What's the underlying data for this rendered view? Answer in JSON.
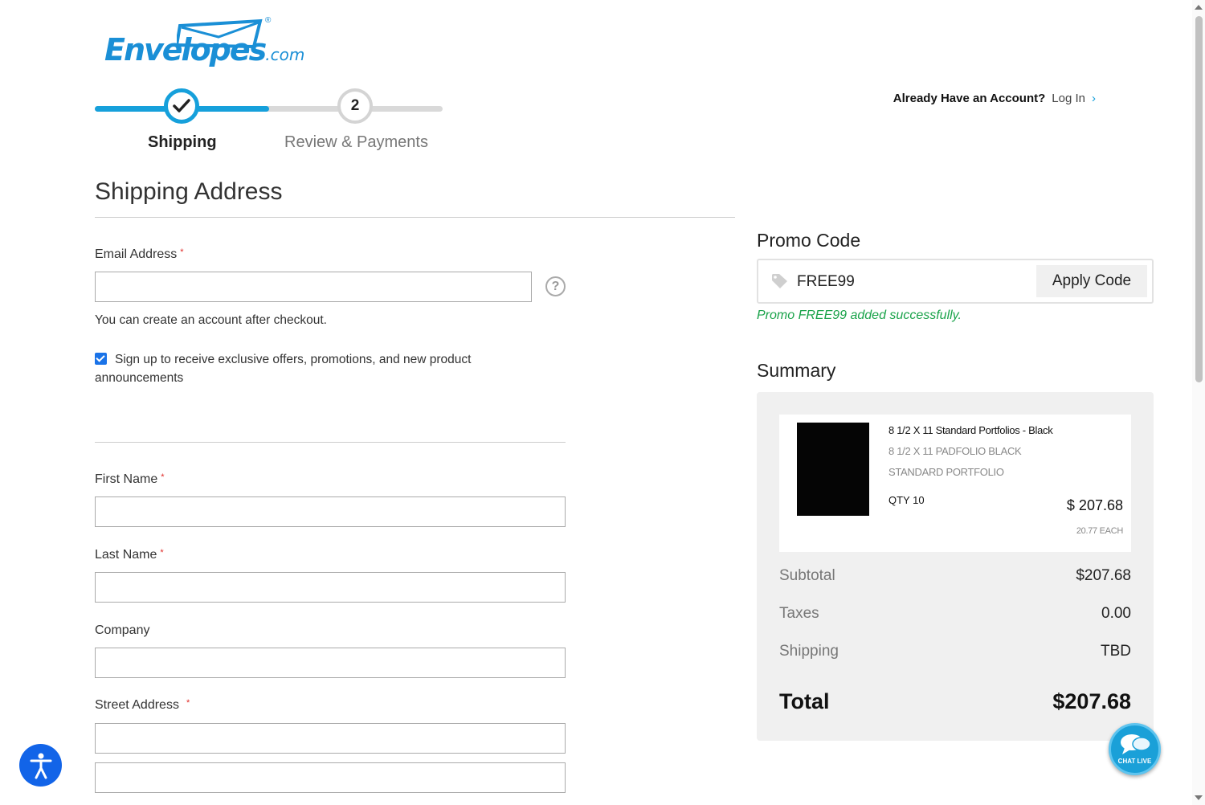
{
  "logo": {
    "text": "Envelopes",
    "suffix": ".com",
    "registered": "®"
  },
  "stepper": {
    "steps": [
      {
        "label": "Shipping",
        "state": "complete"
      },
      {
        "number": "2",
        "label": "Review & Payments",
        "state": "pending"
      }
    ]
  },
  "account": {
    "question": "Already Have an Account?",
    "login_label": "Log In",
    "chevron": "›"
  },
  "shipping": {
    "title": "Shipping Address",
    "email": {
      "label": "Email Address",
      "value": "",
      "help": "?"
    },
    "note": "You can create an account after checkout.",
    "signup": {
      "checked": true,
      "label": "Sign up to receive exclusive offers, promotions, and new product announcements"
    },
    "first_name": {
      "label": "First Name",
      "value": ""
    },
    "last_name": {
      "label": "Last Name",
      "value": ""
    },
    "company": {
      "label": "Company",
      "value": ""
    },
    "street": {
      "label": "Street Address",
      "line1": "",
      "line2": ""
    },
    "required_mark": "*"
  },
  "promo": {
    "title": "Promo Code",
    "value": "FREE99",
    "apply_label": "Apply Code",
    "success": "Promo FREE99 added successfully."
  },
  "summary": {
    "title": "Summary",
    "item": {
      "name": "8 1/2 X 11 Standard Portfolios - Black",
      "option1": "8 1/2 X 11 PADFOLIO   BLACK",
      "option2": "STANDARD PORTFOLIO",
      "qty": "QTY 10",
      "price": "$ 207.68",
      "each": "20.77 EACH"
    },
    "rows": [
      {
        "label": "Subtotal",
        "value": "$207.68"
      },
      {
        "label": "Taxes",
        "value": "0.00"
      },
      {
        "label": "Shipping",
        "value": "TBD"
      }
    ],
    "total": {
      "label": "Total",
      "value": "$207.68"
    }
  },
  "chat": {
    "label": "CHAT LIVE"
  },
  "colors": {
    "brand": "#1a8fd6",
    "step_active": "#16a0db",
    "success": "#1aa34a",
    "required": "#e02b27"
  }
}
